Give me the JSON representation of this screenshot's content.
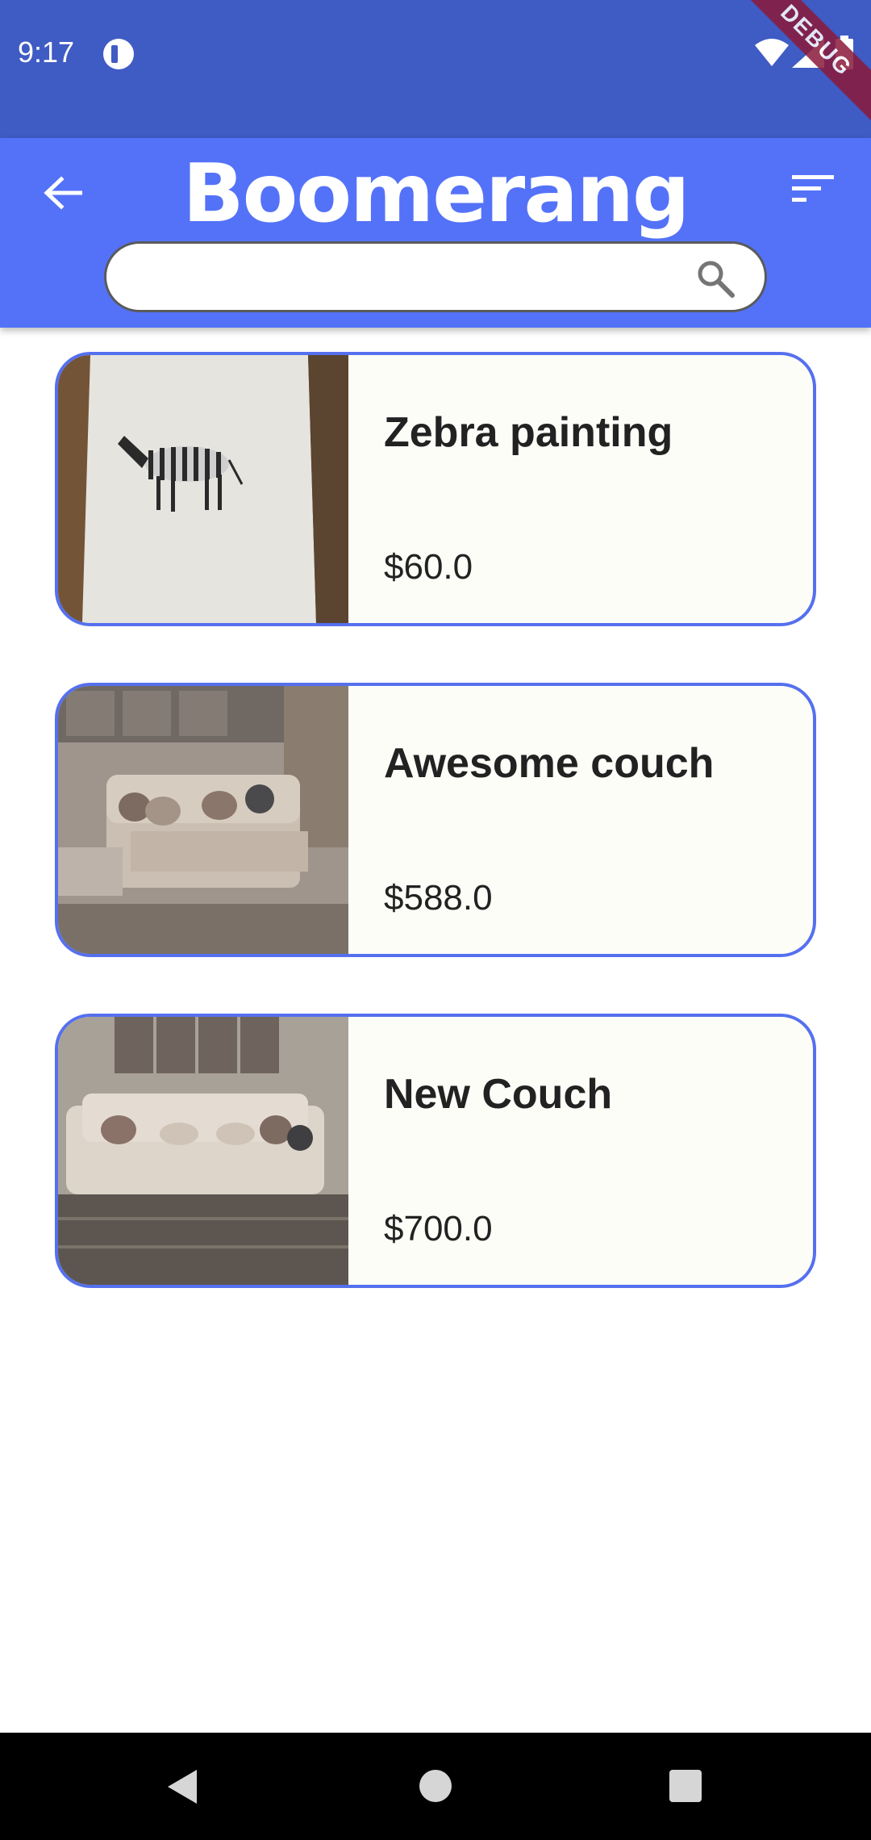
{
  "status_bar": {
    "time": "9:17",
    "debug_label": "DEBUG",
    "icons": [
      "app-notification-icon",
      "wifi-icon",
      "signal-icon",
      "battery-icon"
    ]
  },
  "app_bar": {
    "title": "Boomerang",
    "search": {
      "value": "",
      "placeholder": ""
    },
    "icons": [
      "back-arrow-icon",
      "sort-filter-icon",
      "search-icon"
    ]
  },
  "products": [
    {
      "name": "Zebra painting",
      "price": "$60.0",
      "image": "zebra-painting-photo"
    },
    {
      "name": "Awesome couch",
      "price": "$588.0",
      "image": "beige-couch-photo"
    },
    {
      "name": "New Couch",
      "price": "$700.0",
      "image": "white-couch-photo"
    }
  ],
  "nav_bar": {
    "icons": [
      "nav-back-icon",
      "nav-home-icon",
      "nav-recents-icon"
    ]
  },
  "colors": {
    "status_bar": "#3F5BC4",
    "app_bar": "#5472F8",
    "card_border": "#5570EE",
    "card_background": "#FDFDF8",
    "text": "#222222"
  }
}
